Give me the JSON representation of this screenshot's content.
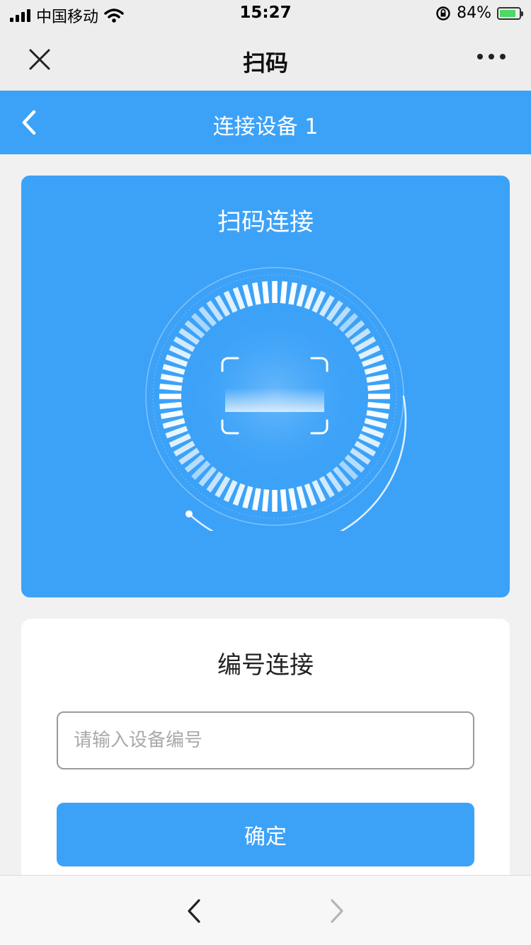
{
  "status_bar": {
    "carrier": "中国移动",
    "time": "15:27",
    "battery_text": "84%",
    "battery_level": 0.84,
    "icons": [
      "signal-icon",
      "wifi-icon",
      "orientation-lock-icon",
      "battery-charging-icon"
    ]
  },
  "title_bar": {
    "title": "扫码",
    "close_icon": "close-icon",
    "more_icon": "more-dots-icon"
  },
  "header": {
    "title": "连接设备 1",
    "back_icon": "chevron-left-icon"
  },
  "scan_card": {
    "title": "扫码连接",
    "icon": "scan-frame-icon"
  },
  "number_card": {
    "title": "编号连接",
    "input_placeholder": "请输入设备编号",
    "input_value": "",
    "confirm_label": "确定"
  },
  "bottom_nav": {
    "back_icon": "nav-back-icon",
    "forward_icon": "nav-forward-icon"
  },
  "colors": {
    "accent": "#3ca2f8",
    "background": "#f1f1f1",
    "card": "#ffffff"
  }
}
